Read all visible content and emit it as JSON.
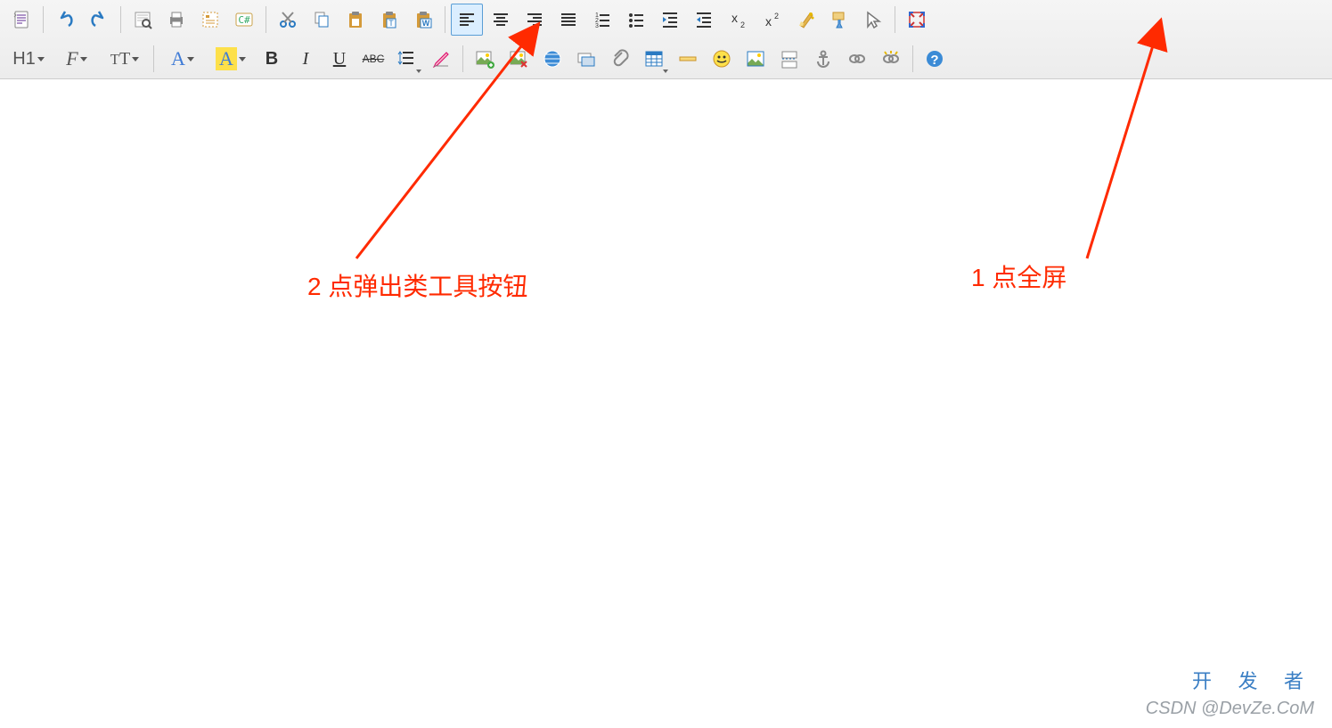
{
  "annotations": {
    "left_label": "2 点弹出类工具按钮",
    "right_label": "1 点全屏"
  },
  "watermark": {
    "line1": "开 发 者",
    "line2": "CSDN @DevZe.CoM"
  },
  "row2": {
    "h1": "H1",
    "family": "F",
    "size": "T",
    "forecolor": "A",
    "backcolor": "A",
    "bold": "B",
    "italic": "I",
    "underline": "U",
    "strike": "ABC"
  },
  "icons": {
    "row1": [
      "source",
      "undo",
      "redo",
      "preview",
      "print",
      "template",
      "code",
      "cut",
      "copy",
      "paste",
      "paste-text",
      "paste-word",
      "align-left",
      "align-center",
      "align-right",
      "align-justify",
      "ordered-list",
      "unordered-list",
      "indent",
      "outdent",
      "subscript",
      "superscript",
      "clear-format",
      "format-painter",
      "select",
      "fullscreen"
    ],
    "row2_tail": [
      "image",
      "flash",
      "media",
      "remote-image",
      "attachment",
      "table",
      "hr",
      "emoticon",
      "special-char",
      "page-break",
      "anchor",
      "link",
      "unlink",
      "about"
    ]
  }
}
